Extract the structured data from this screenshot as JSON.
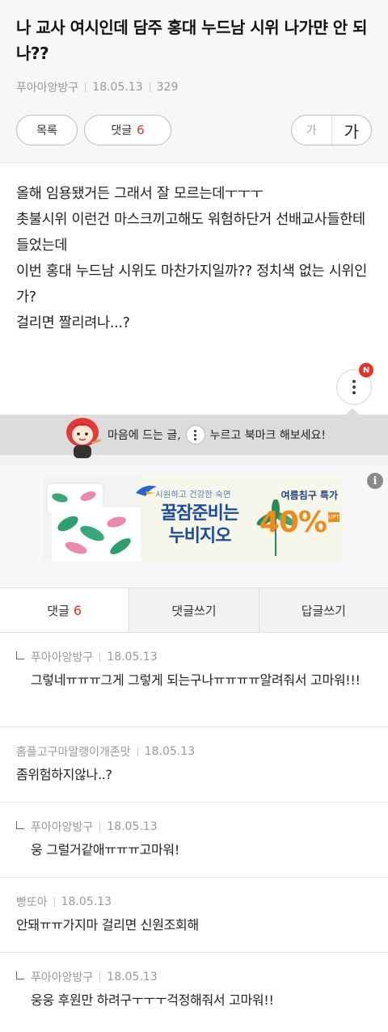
{
  "post": {
    "title": "나 교사 여시인데 담주 홍대 누드남 시위 나가먄 안 되나??",
    "author": "푸아아앙방구",
    "date": "18.05.13",
    "views": "329",
    "list_label": "목록",
    "comment_label": "댓글",
    "comment_count": "6",
    "font_small": "가",
    "font_large": "가",
    "body": [
      "올해 임용됐거든 그래서 잘 모르는데ㅜㅜㅜ",
      "촛불시위 이런건 마스크끼고해도 워험하단거 선배교사들한테 들었는데",
      "이번 홍대 누드남 시위도 마찬가지일까?? 정치색 없는 시위인가?",
      "걸리면 짤리려나...?"
    ]
  },
  "more_badge": "N",
  "tip": {
    "before": "마음에 드는 글,",
    "after": "누르고 북마크 해보세요!"
  },
  "ad": {
    "info": "i",
    "sub": "시원하고 건강한 숙면",
    "main_line1": "꿀잠준비는",
    "main_line2": "누비지오",
    "promo": "여름침구 특가",
    "percent": "40%",
    "upto": "UPTO"
  },
  "tabs": {
    "comments": "댓글",
    "comments_count": "6",
    "write": "댓글쓰기",
    "reply": "답글쓰기"
  },
  "comments": [
    {
      "reply": true,
      "author": "푸아아앙방구",
      "date": "18.05.13",
      "text": "그렇네ㅠㅠㅠ그게 그렇게 되는구나ㅠㅠㅠㅠ알려줘서 고마워!!!"
    },
    {
      "reply": false,
      "author": "홈플고구마말랭이개존맛",
      "date": "18.05.13",
      "text": "좀위험하지않나..?"
    },
    {
      "reply": true,
      "author": "푸아아앙방구",
      "date": "18.05.13",
      "text": "웅 그럴거같애ㅠㅠㅠ고마워!"
    },
    {
      "reply": false,
      "author": "빵또아",
      "date": "18.05.13",
      "text": "안돼ㅠㅠ가지마 걸리면 신원조회해"
    },
    {
      "reply": true,
      "author": "푸아아앙방구",
      "date": "18.05.13",
      "text": "웅웅 후원만 하려구ㅜㅜㅜ걱정해줘서 고마워!!"
    }
  ]
}
